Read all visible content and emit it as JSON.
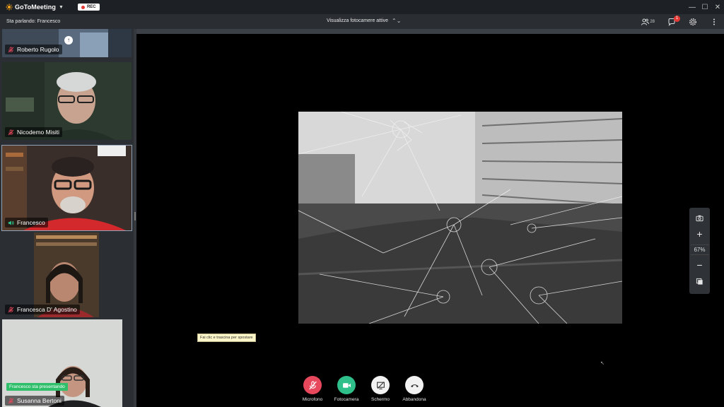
{
  "app": {
    "brand": "GoToMeeting",
    "rec_label": "REC"
  },
  "topbar": {
    "speaking": "Sta parlando: Francesco",
    "camera_selector": "Visualizza fotocamere attive",
    "attendee_count": "28",
    "chat_badge": "1"
  },
  "participants": [
    {
      "name": "Roberto Rugolo",
      "muted": true
    },
    {
      "name": "Nicodemo Misiti",
      "muted": true
    },
    {
      "name": "Francesco",
      "muted": false,
      "speaking": true
    },
    {
      "name": "Francesca D' Agostino",
      "muted": true
    },
    {
      "name": "Susanna Bertoni",
      "muted": true
    }
  ],
  "presenting_label": "Francesco sta presentando",
  "stage": {
    "tooltip": "Fai clic e trascina per spostare"
  },
  "zoom": {
    "level": "67%"
  },
  "controls": {
    "microphone": "Microfono",
    "camera": "Fotocamera",
    "screen": "Schermo",
    "leave": "Abbandona"
  },
  "colors": {
    "accent_green": "#2fbf8a",
    "mute_red": "#e7485c",
    "rec_red": "#e53935"
  }
}
